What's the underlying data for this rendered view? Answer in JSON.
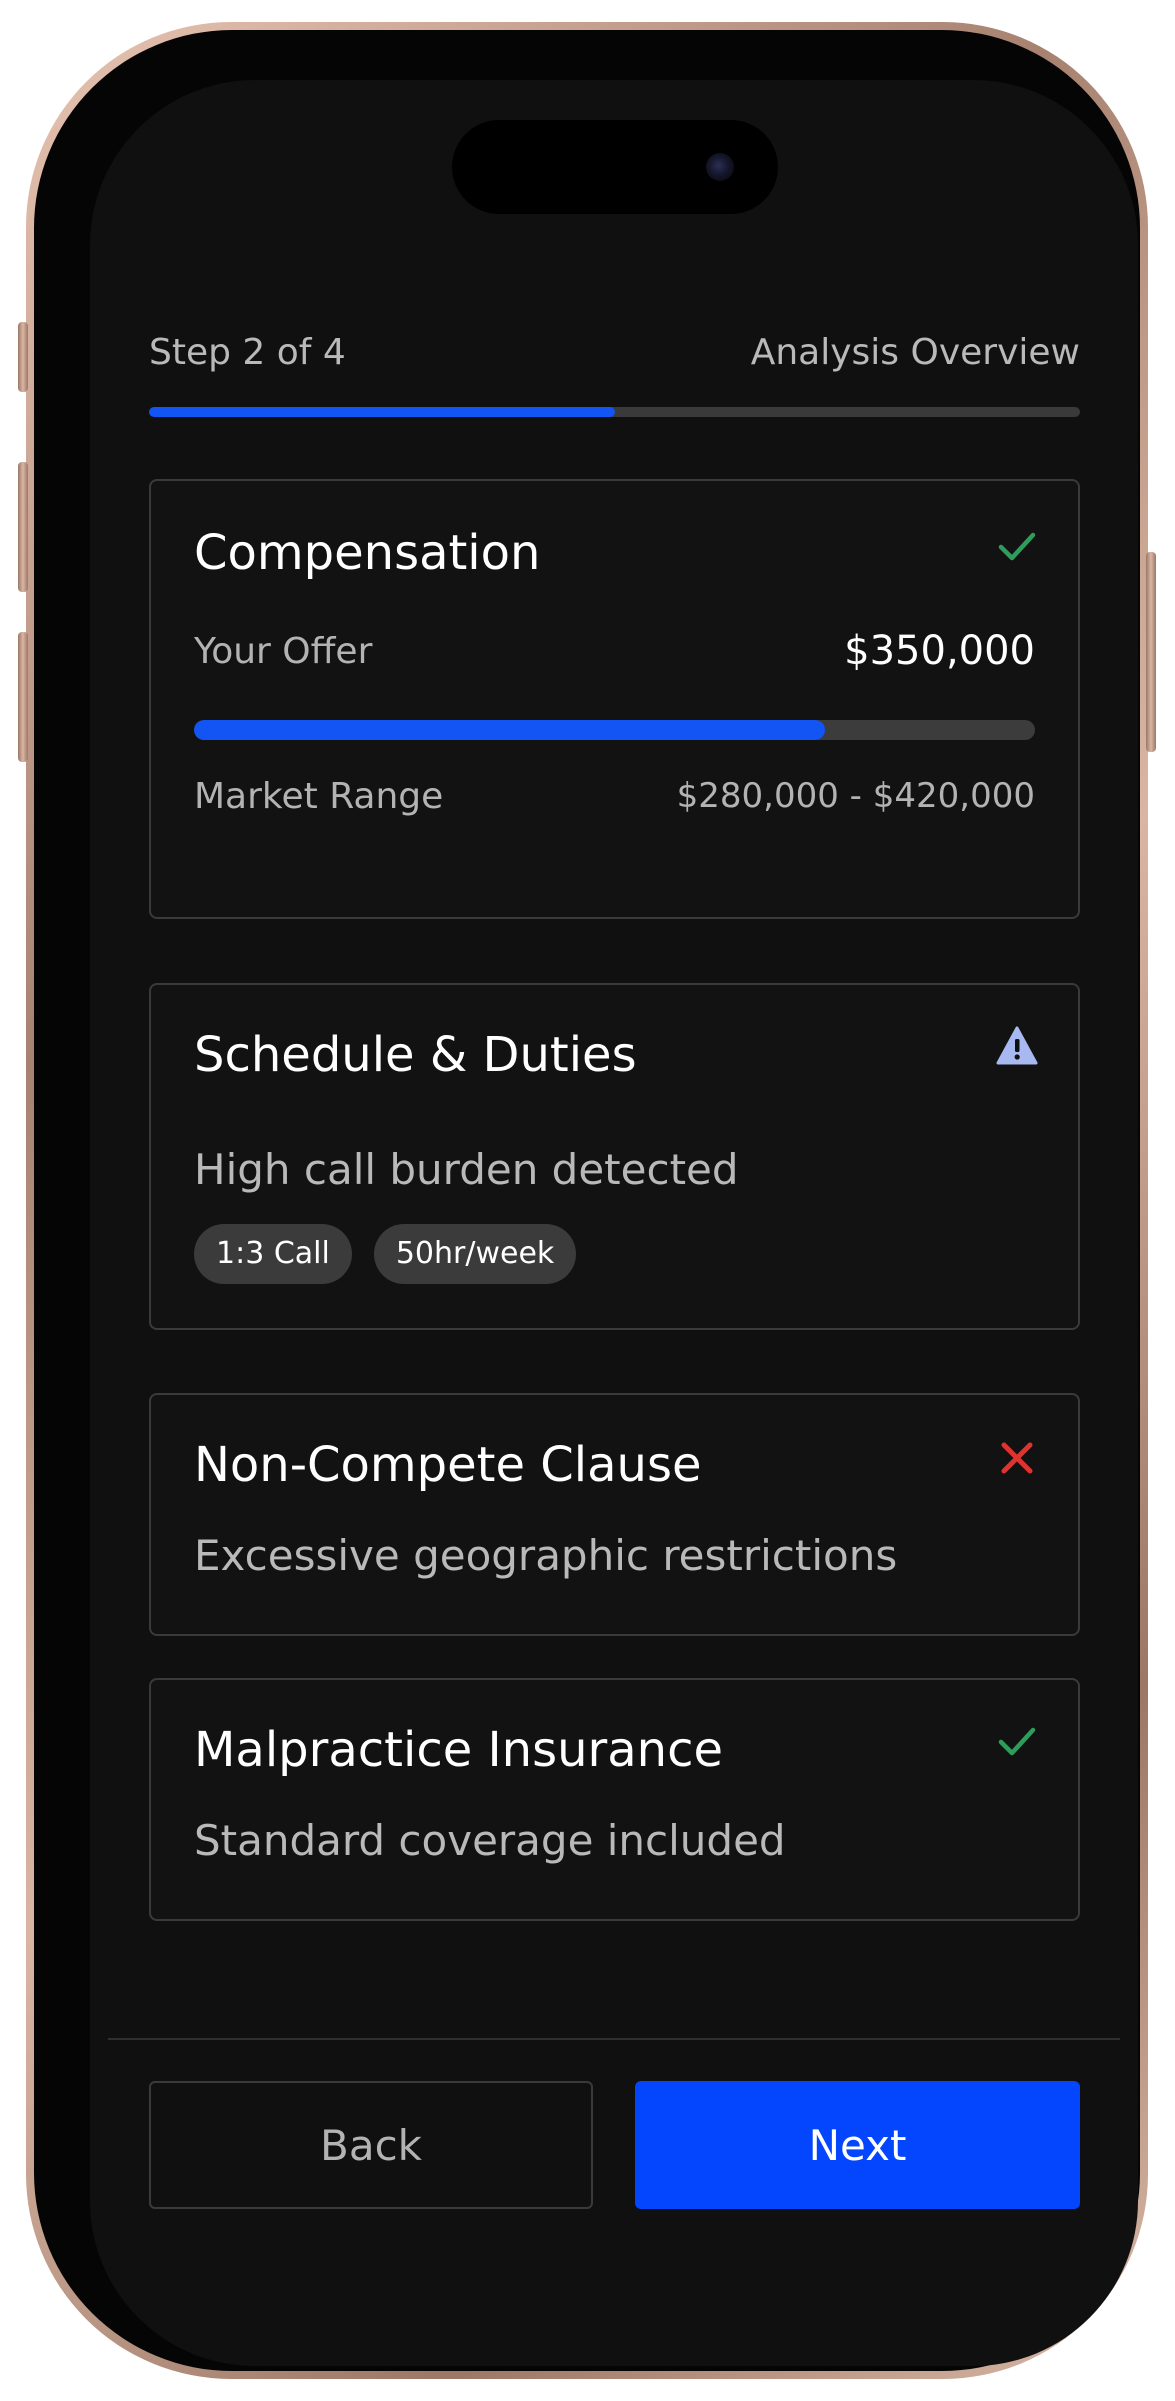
{
  "header": {
    "step_label": "Step 2 of 4",
    "section_title": "Analysis Overview",
    "progress_fraction": 0.5,
    "progress_color": "#1254f4"
  },
  "cards": {
    "compensation": {
      "title": "Compensation",
      "status_icon": "check-icon",
      "status_color": "#2e9c5b",
      "offer_label": "Your Offer",
      "offer_value": "$350,000",
      "offer_bar_fraction": 0.75,
      "market_label": "Market Range",
      "market_value": "$280,000 - $420,000"
    },
    "schedule": {
      "title": "Schedule & Duties",
      "status_icon": "warning-icon",
      "status_color": "#a8b8f0",
      "description": "High call burden detected",
      "chips": [
        "1:3 Call",
        "50hr/week"
      ]
    },
    "non_compete": {
      "title": "Non-Compete Clause",
      "status_icon": "close-icon",
      "status_color": "#e0322f",
      "description": "Excessive geographic restrictions"
    },
    "malpractice": {
      "title": "Malpractice Insurance",
      "status_icon": "check-icon",
      "status_color": "#2e9c5b",
      "description": "Standard coverage included"
    }
  },
  "footer": {
    "back_label": "Back",
    "next_label": "Next",
    "next_color": "#0445fe"
  }
}
